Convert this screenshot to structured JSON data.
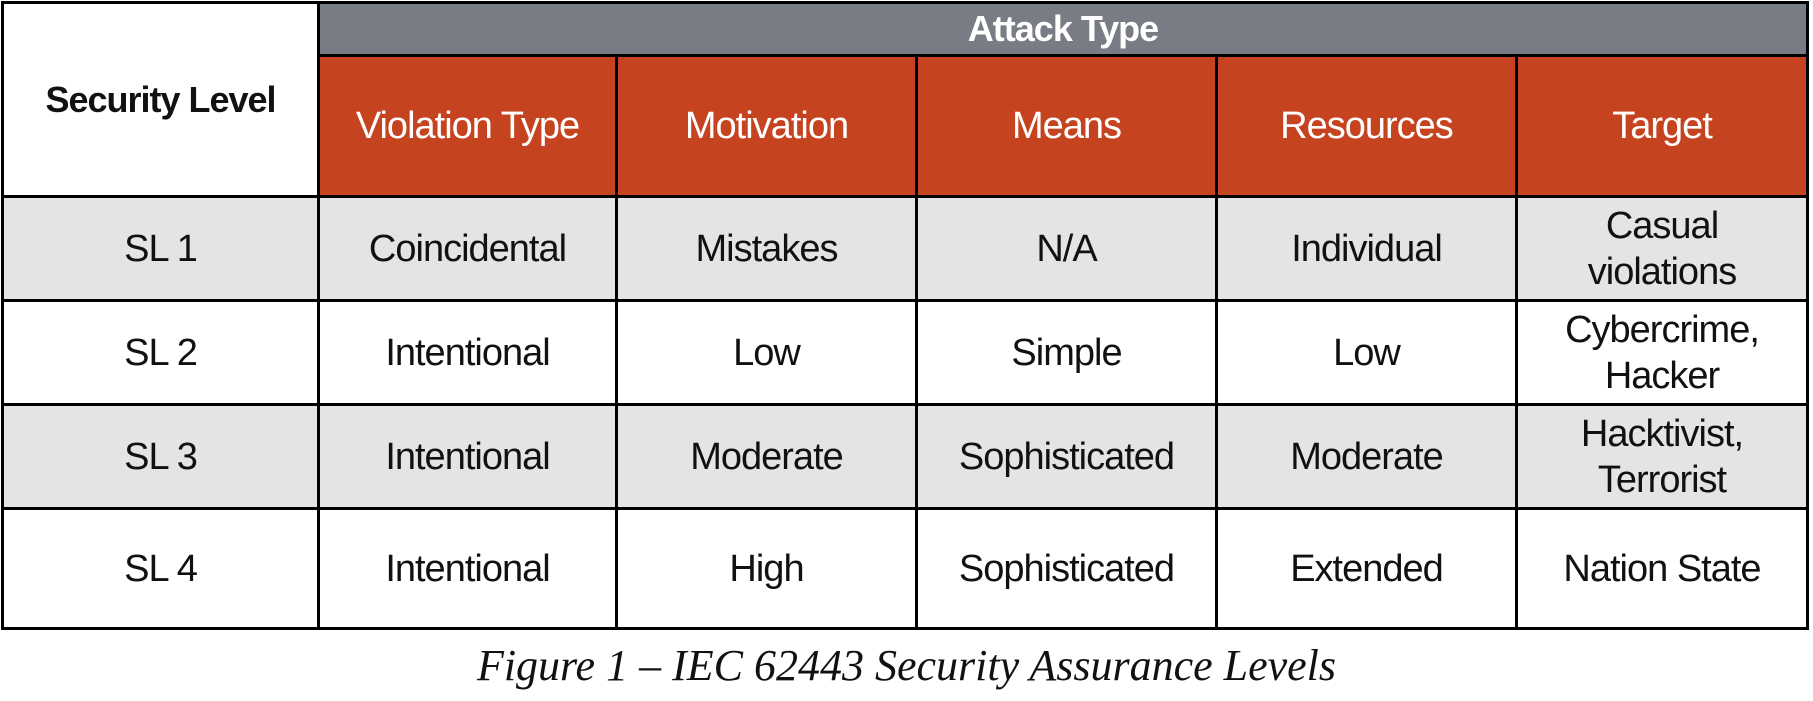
{
  "table": {
    "row_header_label": "Security Level",
    "group_header": "Attack Type",
    "columns": [
      "Violation Type",
      "Motivation",
      "Means",
      "Resources",
      "Target"
    ],
    "rows": [
      {
        "level": "SL 1",
        "cells": [
          "Coincidental",
          "Mistakes",
          "N/A",
          "Individual",
          "Casual violations"
        ]
      },
      {
        "level": "SL 2",
        "cells": [
          "Intentional",
          "Low",
          "Simple",
          "Low",
          "Cybercrime, Hacker"
        ]
      },
      {
        "level": "SL 3",
        "cells": [
          "Intentional",
          "Moderate",
          "Sophisticated",
          "Moderate",
          "Hacktivist, Terrorist"
        ]
      },
      {
        "level": "SL 4",
        "cells": [
          "Intentional",
          "High",
          "Sophisticated",
          "Extended",
          "Nation State"
        ]
      }
    ]
  },
  "caption": "Figure 1 – IEC 62443 Security Assurance Levels",
  "colors": {
    "group_header_bg": "#787c84",
    "column_header_bg": "#c5441f",
    "shaded_row_bg": "#e3e4e6"
  }
}
